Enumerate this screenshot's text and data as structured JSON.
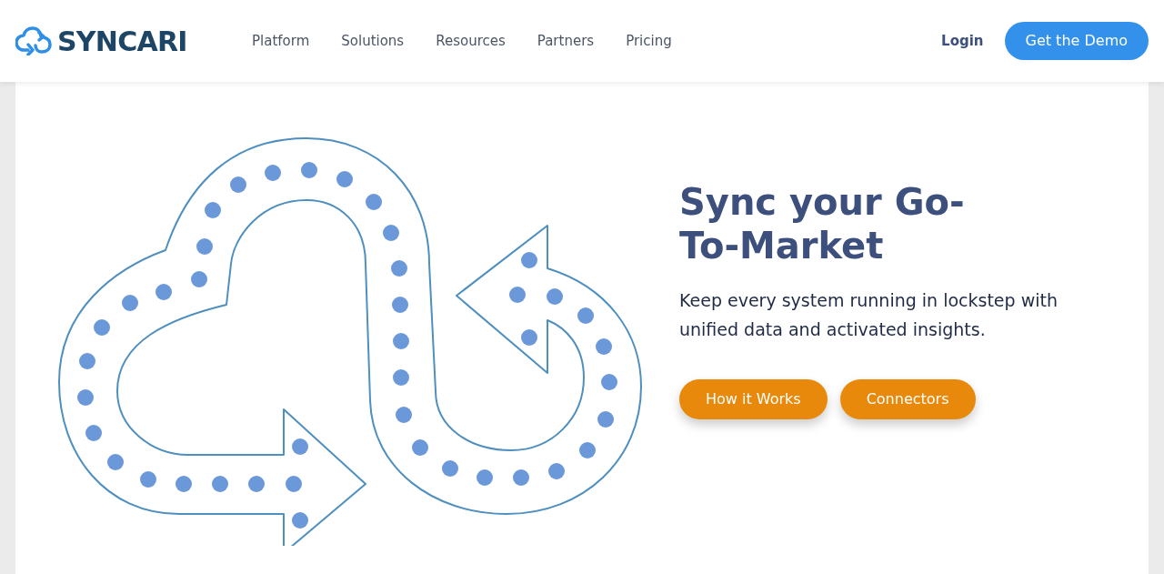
{
  "brand": "SYNCARI",
  "nav": [
    {
      "label": "Platform"
    },
    {
      "label": "Solutions"
    },
    {
      "label": "Resources"
    },
    {
      "label": "Partners"
    },
    {
      "label": "Pricing"
    }
  ],
  "login": "Login",
  "cta": "Get the Demo",
  "hero": {
    "heading": "Sync your Go-To-Market",
    "subtitle": "Keep every system running in lockstep with unified data and activated insights.",
    "buttons": [
      {
        "label": "How it Works"
      },
      {
        "label": "Connectors"
      }
    ]
  }
}
